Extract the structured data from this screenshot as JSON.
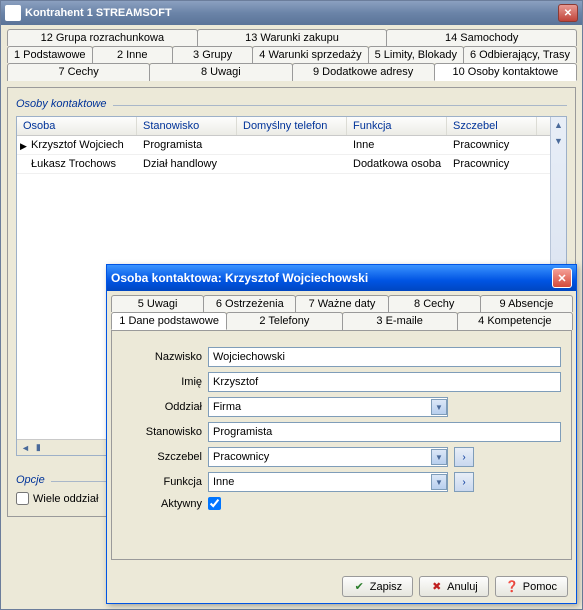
{
  "window": {
    "title": "Kontrahent  1  STREAMSOFT"
  },
  "tabs": {
    "row1": [
      "12 Grupa rozrachunkowa",
      "13 Warunki zakupu",
      "14 Samochody"
    ],
    "row2": [
      "1 Podstawowe",
      "2 Inne",
      "3 Grupy",
      "4 Warunki sprzedaży",
      "5 Limity, Blokady",
      "6 Odbierający, Trasy"
    ],
    "row3": [
      "7 Cechy",
      "8 Uwagi",
      "9 Dodatkowe adresy",
      "10 Osoby kontaktowe"
    ]
  },
  "group": {
    "contacts": "Osoby kontaktowe"
  },
  "grid": {
    "headers": {
      "osoba": "Osoba",
      "stanowisko": "Stanowisko",
      "telefon": "Domyślny telefon",
      "funkcja": "Funkcja",
      "szczebel": "Szczebel"
    },
    "rows": [
      {
        "marker": "▶",
        "osoba": "Krzysztof Wojciech",
        "stanowisko": "Programista",
        "telefon": "",
        "funkcja": "Inne",
        "szczebel": "Pracownicy"
      },
      {
        "marker": "",
        "osoba": "Łukasz Trochows",
        "stanowisko": "Dział handlowy",
        "telefon": "",
        "funkcja": "Dodatkowa osoba",
        "szczebel": "Pracownicy"
      }
    ]
  },
  "options": {
    "label": "Opcje",
    "multi": "Wiele oddział"
  },
  "dialog": {
    "title": "Osoba kontaktowa: Krzysztof Wojciechowski",
    "tabs": {
      "row1": [
        "5 Uwagi",
        "6 Ostrzeżenia",
        "7 Ważne daty",
        "8 Cechy",
        "9 Absencje"
      ],
      "row2": [
        "1 Dane podstawowe",
        "2 Telefony",
        "3 E-maile",
        "4 Kompetencje"
      ]
    },
    "form": {
      "labels": {
        "nazwisko": "Nazwisko",
        "imie": "Imię",
        "oddzial": "Oddział",
        "stanowisko": "Stanowisko",
        "szczebel": "Szczebel",
        "funkcja": "Funkcja",
        "aktywny": "Aktywny"
      },
      "values": {
        "nazwisko": "Wojciechowski",
        "imie": "Krzysztof",
        "oddzial": "Firma",
        "stanowisko": "Programista",
        "szczebel": "Pracownicy",
        "funkcja": "Inne"
      }
    },
    "buttons": {
      "save": "Zapisz",
      "cancel": "Anuluj",
      "help": "Pomoc"
    }
  }
}
